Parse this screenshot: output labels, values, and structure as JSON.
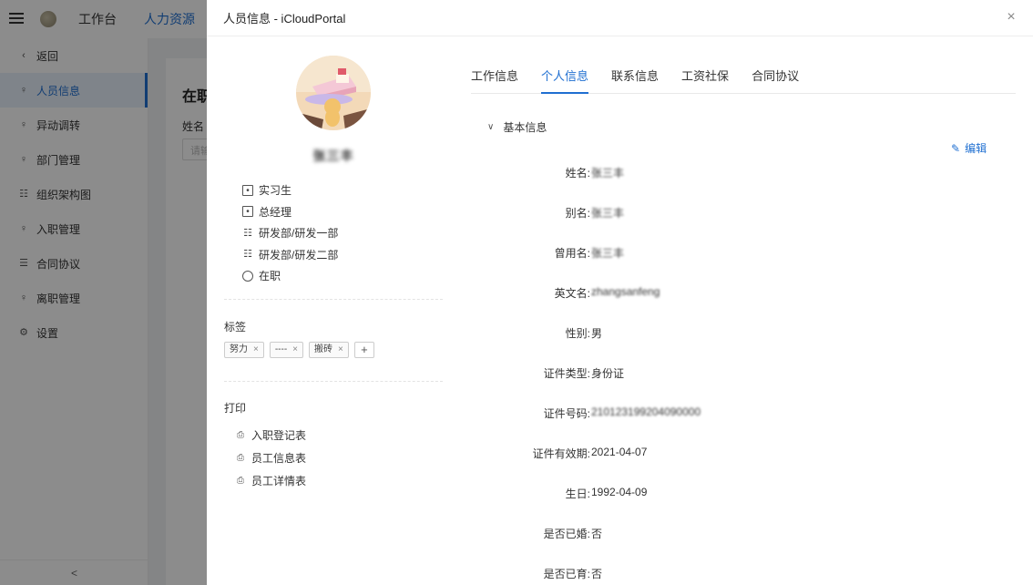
{
  "topbar": {
    "nav": [
      {
        "label": "工作台",
        "active": false
      },
      {
        "label": "人力资源",
        "active": true
      }
    ]
  },
  "sidebar": {
    "items": [
      {
        "label": "返回",
        "icon": "chevron-left-icon",
        "active": false
      },
      {
        "label": "人员信息",
        "icon": "user-icon",
        "active": true
      },
      {
        "label": "异动调转",
        "icon": "user-icon",
        "active": false
      },
      {
        "label": "部门管理",
        "icon": "user-icon",
        "active": false
      },
      {
        "label": "组织架构图",
        "icon": "org-chart-icon",
        "active": false
      },
      {
        "label": "入职管理",
        "icon": "user-icon",
        "active": false
      },
      {
        "label": "合同协议",
        "icon": "document-icon",
        "active": false
      },
      {
        "label": "离职管理",
        "icon": "user-icon",
        "active": false
      },
      {
        "label": "设置",
        "icon": "gear-icon",
        "active": false
      }
    ],
    "collapse_label": "<"
  },
  "background_page": {
    "title": "在职",
    "filter_label": "姓名",
    "input_placeholder": "请输"
  },
  "drawer": {
    "title": "人员信息 - iCloudPortal",
    "close_label": "×",
    "profile": {
      "name": "张三丰",
      "info": [
        {
          "icon": "badge-icon",
          "text": "实习生"
        },
        {
          "icon": "badge-icon",
          "text": "总经理"
        },
        {
          "icon": "org-icon",
          "text": "研发部/研发一部"
        },
        {
          "icon": "org-icon",
          "text": "研发部/研发二部"
        },
        {
          "icon": "clock-icon",
          "text": "在职"
        }
      ]
    },
    "tags_label": "标签",
    "tags": [
      "努力",
      "----",
      "搬砖"
    ],
    "tag_add_label": "+",
    "print_label": "打印",
    "print_items": [
      "入职登记表",
      "员工信息表",
      "员工详情表"
    ],
    "tabs": [
      {
        "label": "工作信息",
        "active": false
      },
      {
        "label": "个人信息",
        "active": true
      },
      {
        "label": "联系信息",
        "active": false
      },
      {
        "label": "工资社保",
        "active": false
      },
      {
        "label": "合同协议",
        "active": false
      }
    ],
    "section_title": "基本信息",
    "edit_label": "编辑",
    "fields": [
      {
        "label": "姓名:",
        "value": "张三丰",
        "blurred": true
      },
      {
        "label": "别名:",
        "value": "张三丰",
        "blurred": true
      },
      {
        "label": "曾用名:",
        "value": "张三丰",
        "blurred": true
      },
      {
        "label": "英文名:",
        "value": "zhangsanfeng",
        "blurred": true
      },
      {
        "label": "性别:",
        "value": "男",
        "blurred": false
      },
      {
        "label": "证件类型:",
        "value": "身份证",
        "blurred": false
      },
      {
        "label": "证件号码:",
        "value": "210123199204090000",
        "blurred": true
      },
      {
        "label": "证件有效期:",
        "value": "2021-04-07",
        "blurred": false
      },
      {
        "label": "生日:",
        "value": "1992-04-09",
        "blurred": false
      },
      {
        "label": "是否已婚:",
        "value": "否",
        "blurred": false
      },
      {
        "label": "是否已育:",
        "value": "否",
        "blurred": false
      }
    ]
  }
}
